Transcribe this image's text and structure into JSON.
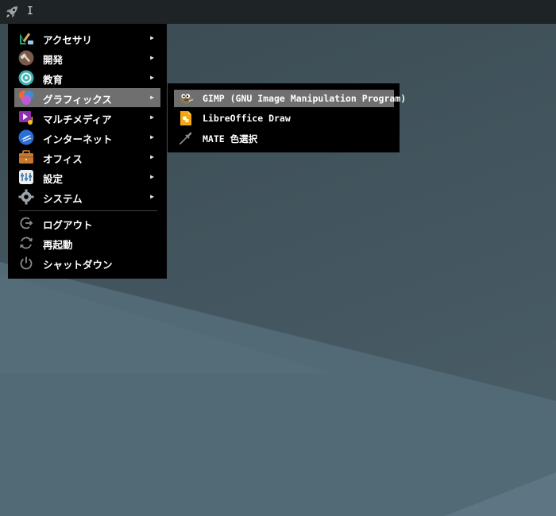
{
  "panel": {
    "cursor_text": "I",
    "launcher_icon": "rocket-icon"
  },
  "menu": {
    "categories": [
      {
        "label": "アクセサリ",
        "icon": "accessories-icon"
      },
      {
        "label": "開発",
        "icon": "development-icon"
      },
      {
        "label": "教育",
        "icon": "education-icon"
      },
      {
        "label": "グラフィックス",
        "icon": "graphics-icon",
        "active": true
      },
      {
        "label": "マルチメディア",
        "icon": "multimedia-icon"
      },
      {
        "label": "インターネット",
        "icon": "internet-icon"
      },
      {
        "label": "オフィス",
        "icon": "office-icon"
      },
      {
        "label": "設定",
        "icon": "settings-icon"
      },
      {
        "label": "システム",
        "icon": "system-icon"
      }
    ],
    "arrow": "▶",
    "actions": [
      {
        "label": "ログアウト",
        "icon": "logout-icon"
      },
      {
        "label": "再起動",
        "icon": "restart-icon"
      },
      {
        "label": "シャットダウン",
        "icon": "shutdown-icon"
      }
    ]
  },
  "submenu": {
    "items": [
      {
        "label": "GIMP (GNU Image Manipulation Program)",
        "icon": "gimp-icon",
        "active": true
      },
      {
        "label": "LibreOffice Draw",
        "icon": "libreoffice-draw-icon"
      },
      {
        "label": "MATE 色選択",
        "icon": "color-picker-icon"
      }
    ]
  }
}
